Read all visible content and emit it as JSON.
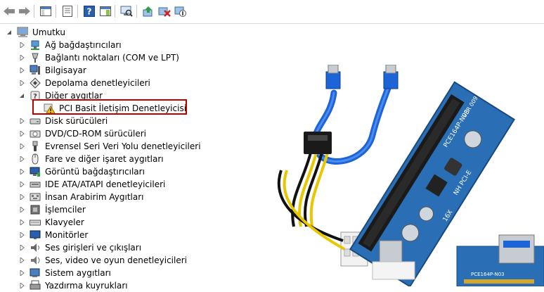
{
  "toolbar": {
    "buttons": [
      "back-icon",
      "forward-icon",
      "console-tree-icon",
      "properties-icon",
      "help-icon",
      "action-pane-icon",
      "scan-hardware-icon",
      "update-driver-icon",
      "uninstall-device-icon",
      "disable-device-icon"
    ]
  },
  "tree": {
    "root": "Umutku",
    "categories": [
      {
        "label": "Ağ bağdaştırıcıları",
        "icon": "network-adapter-icon",
        "expanded": false
      },
      {
        "label": "Bağlantı noktaları (COM ve LPT)",
        "icon": "port-icon",
        "expanded": false
      },
      {
        "label": "Bilgisayar",
        "icon": "computer-icon",
        "expanded": false
      },
      {
        "label": "Depolama denetleyicileri",
        "icon": "storage-controller-icon",
        "expanded": false
      },
      {
        "label": "Diğer aygıtlar",
        "icon": "unknown-device-icon",
        "expanded": true,
        "children": [
          {
            "label": "PCI Basit İletişim Denetleyicisi",
            "icon": "warning-device-icon"
          }
        ]
      },
      {
        "label": "Disk sürücüleri",
        "icon": "disk-drive-icon",
        "expanded": false
      },
      {
        "label": "DVD/CD-ROM sürücüleri",
        "icon": "dvd-icon",
        "expanded": false
      },
      {
        "label": "Evrensel Seri Veri Yolu denetleyicileri",
        "icon": "usb-icon",
        "expanded": false
      },
      {
        "label": "Fare ve diğer işaret aygıtları",
        "icon": "mouse-icon",
        "expanded": false
      },
      {
        "label": "Görüntü bağdaştırıcıları",
        "icon": "display-adapter-icon",
        "expanded": false
      },
      {
        "label": "IDE ATA/ATAPI denetleyicileri",
        "icon": "ide-icon",
        "expanded": false
      },
      {
        "label": "İnsan Arabirim Aygıtları",
        "icon": "hid-icon",
        "expanded": false
      },
      {
        "label": "İşlemciler",
        "icon": "processor-icon",
        "expanded": false
      },
      {
        "label": "Klavyeler",
        "icon": "keyboard-icon",
        "expanded": false
      },
      {
        "label": "Monitörler",
        "icon": "monitor-icon",
        "expanded": false
      },
      {
        "label": "Ses girişleri ve çıkışları",
        "icon": "audio-io-icon",
        "expanded": false
      },
      {
        "label": "Ses, video ve oyun denetleyicileri",
        "icon": "sound-icon",
        "expanded": false
      },
      {
        "label": "Sistem aygıtları",
        "icon": "system-device-icon",
        "expanded": false
      },
      {
        "label": "Yazdırma kuyrukları",
        "icon": "print-queue-icon",
        "expanded": false
      }
    ]
  },
  "photo": {
    "board_silk": [
      "VER 009",
      "PCE164P-N03",
      "NH PCI-E",
      "16X",
      "PCE164P-N03"
    ]
  },
  "colors": {
    "highlight": "#c00000",
    "pcb": "#2a6fb5",
    "cable": "#1d64d6"
  }
}
